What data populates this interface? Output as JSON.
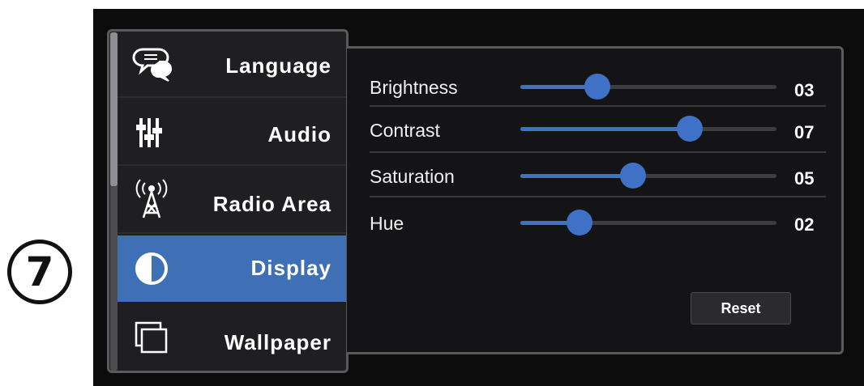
{
  "step": {
    "number": "7"
  },
  "sidebar": {
    "items": [
      {
        "label": "Language",
        "icon": "chat-bubbles-icon",
        "active": false
      },
      {
        "label": "Audio",
        "icon": "equalizer-icon",
        "active": false
      },
      {
        "label": "Radio Area",
        "icon": "radio-tower-icon",
        "active": false
      },
      {
        "label": "Display",
        "icon": "contrast-icon",
        "active": true
      },
      {
        "label": "Wallpaper",
        "icon": "wallpaper-icon",
        "active": false
      }
    ]
  },
  "display_settings": {
    "rows": [
      {
        "label": "Brightness",
        "value": "03",
        "level": 0.3
      },
      {
        "label": "Contrast",
        "value": "07",
        "level": 0.66
      },
      {
        "label": "Saturation",
        "value": "05",
        "level": 0.44
      },
      {
        "label": "Hue",
        "value": "02",
        "level": 0.23
      }
    ],
    "reset_label": "Reset"
  },
  "colors": {
    "accent": "#3f72c6",
    "active_menu": "#3f6fb5",
    "background": "#0c0c0d",
    "panel": "#141416"
  }
}
